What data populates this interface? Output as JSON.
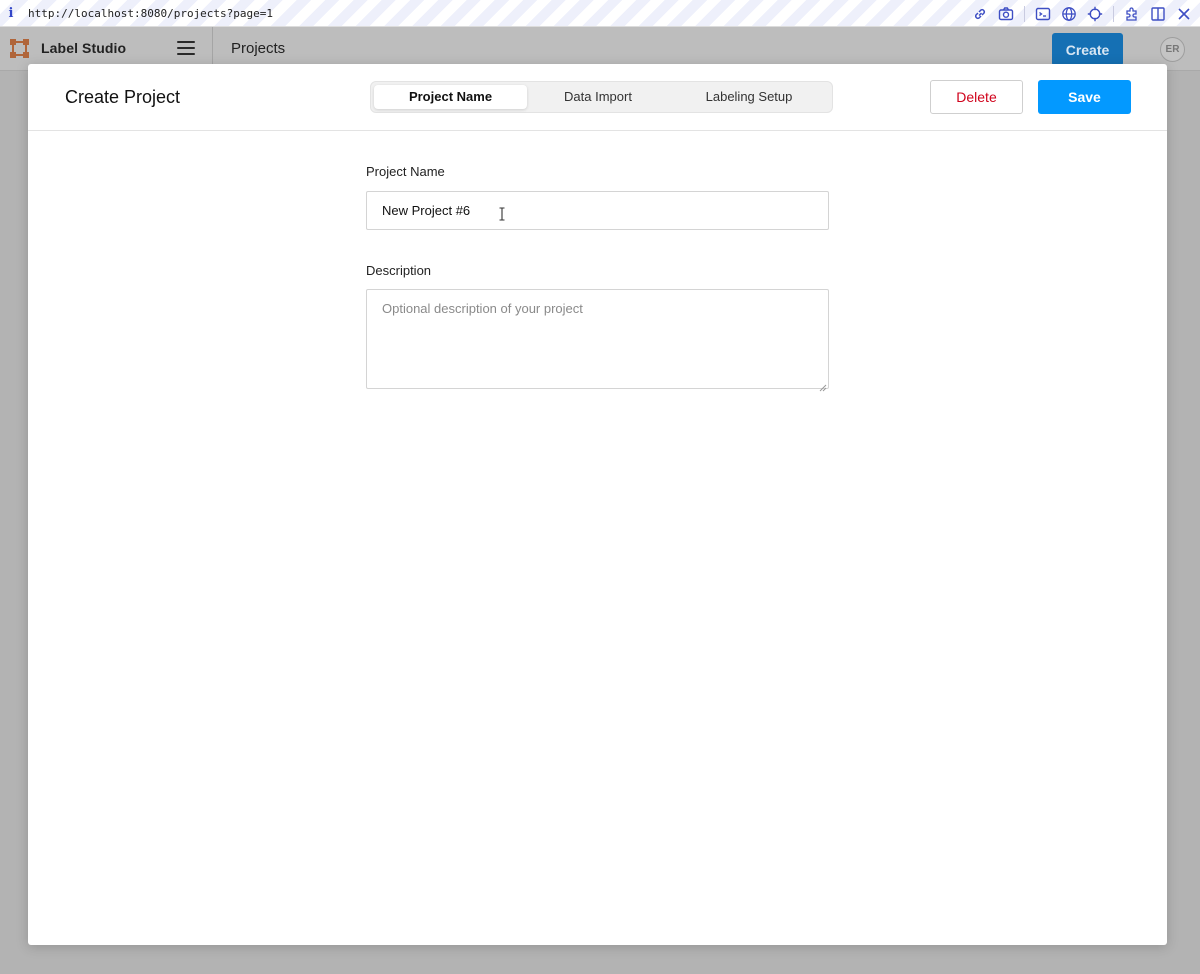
{
  "browser": {
    "url": "http://localhost:8080/projects?page=1",
    "toolbar_icons": [
      "link-icon",
      "camera-icon",
      "terminal-icon",
      "globe-icon",
      "crosshair-icon",
      "extension-icon",
      "split-view-icon",
      "close-icon"
    ]
  },
  "app": {
    "brand": "Label Studio",
    "page_title": "Projects",
    "create_label": "Create",
    "avatar_initials": "ER"
  },
  "modal": {
    "title": "Create Project",
    "tabs": [
      {
        "label": "Project Name",
        "active": true
      },
      {
        "label": "Data Import",
        "active": false
      },
      {
        "label": "Labeling Setup",
        "active": false
      }
    ],
    "delete_label": "Delete",
    "save_label": "Save",
    "form": {
      "name_label": "Project Name",
      "name_value": "New Project #6",
      "description_label": "Description",
      "description_placeholder": "Optional description of your project",
      "description_value": ""
    }
  },
  "colors": {
    "accent": "#0399ff",
    "delete": "#d0021b",
    "brand_logo": "#e0783d"
  }
}
